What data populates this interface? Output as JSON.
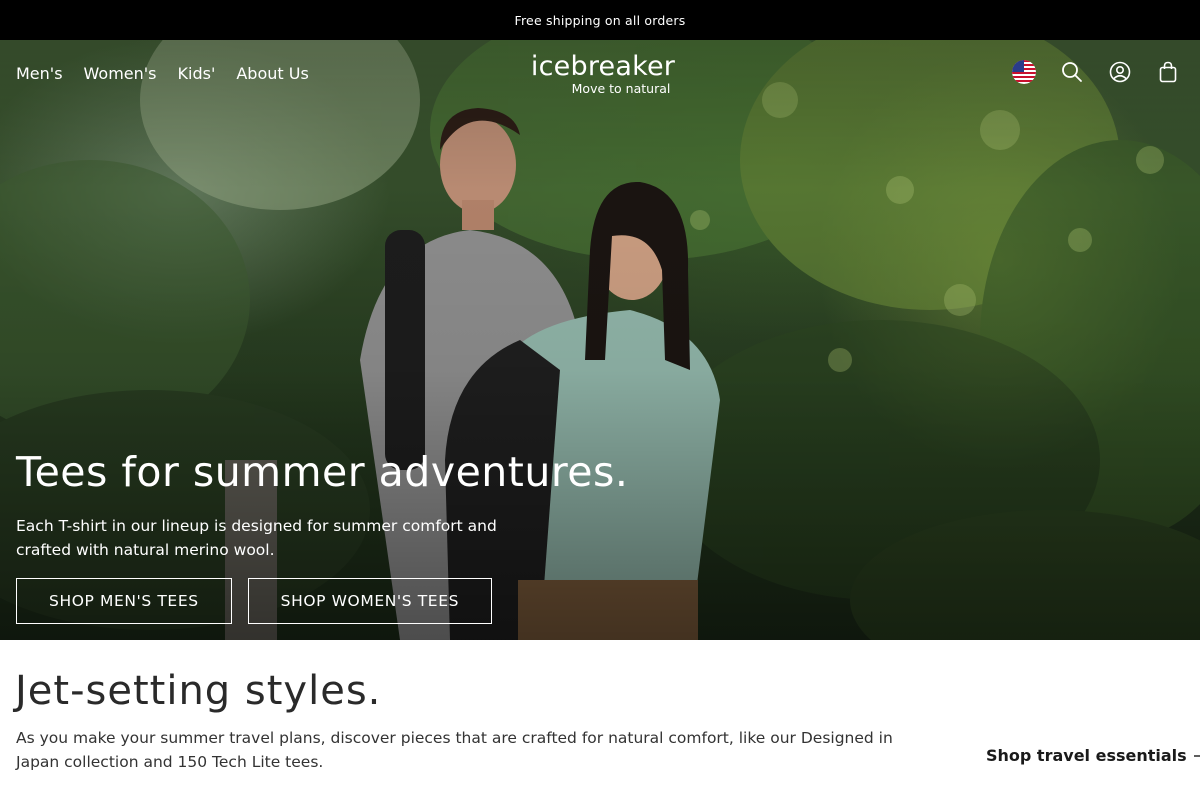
{
  "announcement": {
    "text": "Free shipping on all orders"
  },
  "nav": {
    "left": [
      "Men's",
      "Women's",
      "Kids'",
      "About Us"
    ],
    "right_icons": [
      "us-flag-icon",
      "search-icon",
      "account-icon",
      "cart-icon"
    ]
  },
  "logo": {
    "wordmark": "icebreaker",
    "tagline": "Move to natural"
  },
  "hero": {
    "title": "Tees for summer adventures.",
    "subtitle": "Each T-shirt in our lineup is designed for summer comfort and crafted with natural merino wool.",
    "cta_men": "SHOP MEN'S TEES",
    "cta_women": "SHOP WOMEN'S TEES"
  },
  "editorial": {
    "title": "Jet-setting styles.",
    "body": "As you make your summer travel plans, discover pieces that are crafted for natural comfort, like our Designed in Japan collection and 150 Tech Lite tees.",
    "link": "Shop travel essentials"
  },
  "colors": {
    "announcement_bg": "#000000",
    "text_on_hero": "#ffffff",
    "page_bg": "#ffffff"
  }
}
